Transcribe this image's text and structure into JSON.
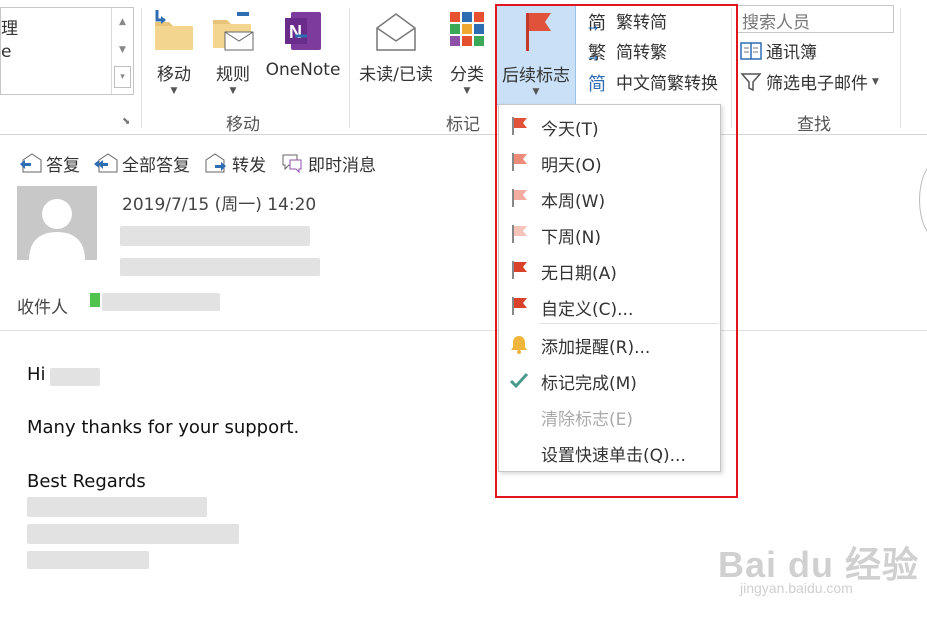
{
  "ribbon": {
    "quick_items": [
      "理",
      "e"
    ],
    "move_group": {
      "label": "移动",
      "buttons": [
        {
          "label": "移动"
        },
        {
          "label": "规则"
        },
        {
          "label": "OneNote"
        }
      ]
    },
    "tags_group": {
      "label": "标记",
      "buttons": [
        {
          "label": "未读/已读"
        },
        {
          "label": "分类"
        },
        {
          "label": "后续标志"
        }
      ]
    },
    "chinese_conversion": [
      "繁转简",
      "简转繁",
      "中文简繁转换"
    ],
    "find_group": {
      "label": "查找",
      "search_placeholder": "搜索人员",
      "address_book": "通讯簿",
      "filter_email": "筛选电子邮件"
    }
  },
  "message": {
    "actions": [
      "答复",
      "全部答复",
      "转发",
      "即时消息"
    ],
    "datetime": "2019/7/15 (周一) 14:20",
    "to_label": "收件人",
    "body": {
      "greeting": "Hi",
      "line1": "Many thanks for your support.",
      "closing": "Best Regards"
    }
  },
  "flag_menu": {
    "items": [
      {
        "label": "今天(T)",
        "icon": "flag-icon",
        "color": "#e0533a"
      },
      {
        "label": "明天(O)",
        "icon": "flag-icon",
        "color": "#ec8b7a"
      },
      {
        "label": "本周(W)",
        "icon": "flag-icon",
        "color": "#f2aca0"
      },
      {
        "label": "下周(N)",
        "icon": "flag-icon",
        "color": "#f5c3ba"
      },
      {
        "label": "无日期(A)",
        "icon": "flag-icon",
        "color": "#d9412b"
      },
      {
        "label": "自定义(C)...",
        "icon": "flag-icon",
        "color": "#d9412b"
      },
      {
        "label": "添加提醒(R)...",
        "icon": "bell-icon",
        "color": "#f0b63c"
      },
      {
        "label": "标记完成(M)",
        "icon": "checkmark-icon",
        "color": "#4a9a8c"
      },
      {
        "label": "清除标志(E)",
        "icon": "none",
        "disabled": true
      },
      {
        "label": "设置快速单击(Q)...",
        "icon": "none"
      }
    ]
  },
  "watermark": {
    "main": "Bai du 经验",
    "sub": "jingyan.baidu.com"
  },
  "colors": {
    "highlight": "#e0151e",
    "selected_button": "#c9e0f7"
  }
}
